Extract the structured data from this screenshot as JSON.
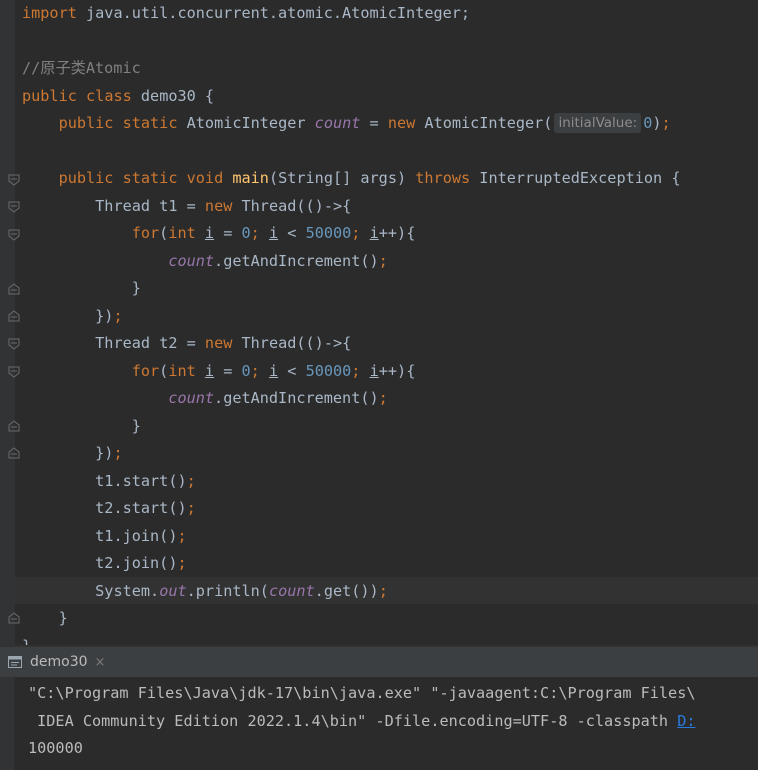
{
  "editor": {
    "import_keyword": "import",
    "import_path": " java.util.concurrent.atomic.AtomicInteger;",
    "comment": "//原子类Atomic",
    "kw_public": "public",
    "kw_class": "class",
    "class_name": "demo30",
    "kw_static": "static",
    "kw_new": "new",
    "kw_void": "void",
    "kw_throws": "throws",
    "kw_for": "for",
    "kw_int": "int",
    "type_atomic": "AtomicInteger",
    "field_count": "count",
    "field_out": "out",
    "param_hint": "initialValue:",
    "num_zero": "0",
    "num_limit": "50000",
    "method_main": "main",
    "main_params": "(String[] args)",
    "exception_type": "InterruptedException",
    "var_i": "i",
    "thread_type": "Thread",
    "t1": "t1",
    "t2": "t2",
    "get_and_increment": "getAndIncrement",
    "t1_start": "t1.start",
    "t2_start": "t2.start",
    "t1_join": "t1.join",
    "t2_join": "t2.join",
    "system": "System",
    "println": "println",
    "get": "get"
  },
  "run_tab": {
    "label": "demo30",
    "close": "×"
  },
  "console": {
    "line1": "\"C:\\Program Files\\Java\\jdk-17\\bin\\java.exe\" \"-javaagent:C:\\Program Files\\",
    "line2_text": " IDEA Community Edition 2022.1.4\\bin\" -Dfile.encoding=UTF-8 -classpath ",
    "line2_link": "D:",
    "line3": "100000"
  },
  "colors": {
    "keyword": "#cc7832",
    "field": "#9876aa",
    "number": "#6897bb",
    "method": "#ffc66d",
    "comment": "#808080",
    "text": "#a9b7c6",
    "background": "#2b2b2b",
    "link": "#287bde"
  }
}
